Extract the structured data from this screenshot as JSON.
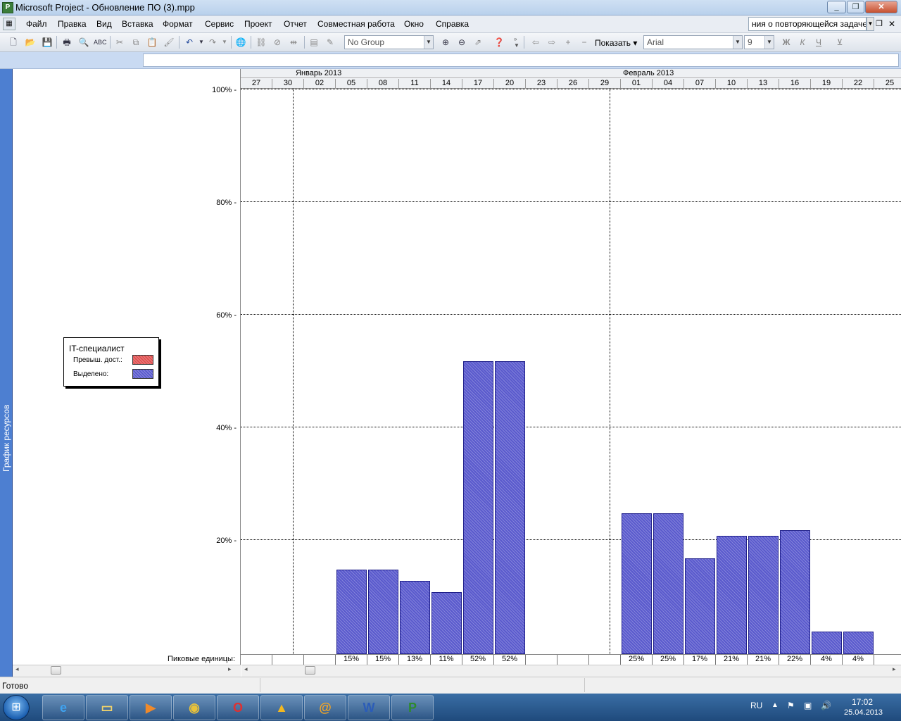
{
  "window": {
    "title": "Microsoft Project - Обновление ПО (3).mpp",
    "app_icon": "msproject-icon"
  },
  "menu": {
    "items": [
      "Файл",
      "Правка",
      "Вид",
      "Вставка",
      "Формат",
      "Сервис",
      "Проект",
      "Отчет",
      "Совместная работа",
      "Окно",
      "Справка"
    ],
    "help_box": "ния о повторяющейся задаче"
  },
  "toolbar": {
    "group_combo": "No Group",
    "show_label": "Показать",
    "font_combo": "Arial",
    "size_combo": "9",
    "bold": "Ж",
    "italic": "К",
    "underline": "Ч"
  },
  "view_bar": {
    "label": "График ресурсов"
  },
  "timescale": {
    "months": [
      "Январь 2013",
      "Февраль 2013"
    ],
    "days": [
      "27",
      "30",
      "02",
      "05",
      "08",
      "11",
      "14",
      "17",
      "20",
      "23",
      "26",
      "29",
      "01",
      "04",
      "07",
      "10",
      "13",
      "16",
      "19",
      "22",
      "25"
    ]
  },
  "legend": {
    "resource": "IT-специалист",
    "overalloc_label": "Превыш. дост.:",
    "allocated_label": "Выделено:",
    "overalloc_color": "#e05050",
    "allocated_color": "#5a5acd"
  },
  "chart_data": {
    "type": "bar",
    "ylabels": [
      "100% -",
      "80% -",
      "60% -",
      "40% -",
      "20% -"
    ],
    "yvalues": [
      100,
      80,
      60,
      40,
      20
    ],
    "ylim": [
      0,
      100
    ],
    "categories": [
      "27",
      "30",
      "02",
      "05",
      "08",
      "11",
      "14",
      "17",
      "20",
      "23",
      "26",
      "29",
      "01",
      "04",
      "07",
      "10",
      "13",
      "16",
      "19",
      "22",
      "25"
    ],
    "values": [
      0,
      0,
      0,
      15,
      15,
      13,
      11,
      52,
      52,
      0,
      0,
      0,
      25,
      25,
      17,
      21,
      21,
      22,
      4,
      4,
      0
    ],
    "peak_labels": [
      "",
      "",
      "",
      "15%",
      "15%",
      "13%",
      "11%",
      "52%",
      "52%",
      "",
      "",
      "",
      "25%",
      "25%",
      "17%",
      "21%",
      "21%",
      "22%",
      "4%",
      "4%",
      ""
    ],
    "peak_row_label": "Пиковые единицы:"
  },
  "status": {
    "text": "Готово"
  },
  "taskbar": {
    "lang": "RU",
    "time": "17:02",
    "date": "25.04.2013"
  }
}
